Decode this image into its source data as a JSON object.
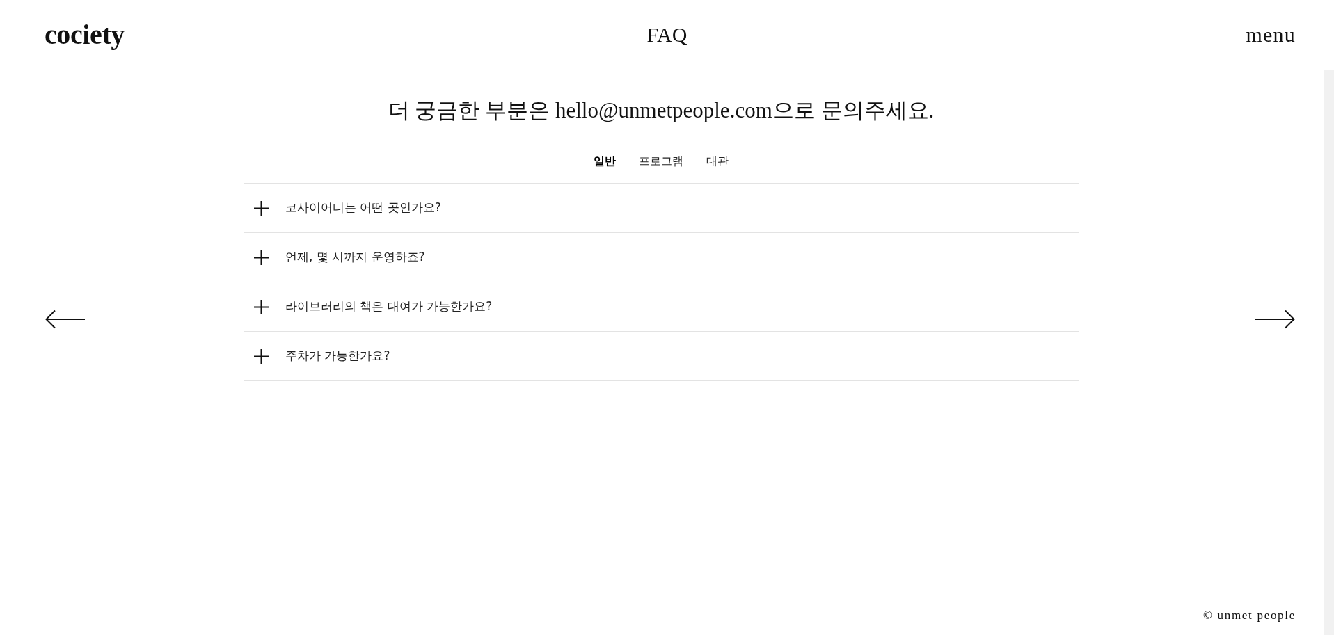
{
  "header": {
    "logo": "cociety",
    "title": "FAQ",
    "menu": "menu"
  },
  "intro": "더 궁금한 부분은 hello@unmetpeople.com으로 문의주세요.",
  "tabs": [
    {
      "label": "일반",
      "selected": true
    },
    {
      "label": "프로그램",
      "selected": false
    },
    {
      "label": "대관",
      "selected": false
    }
  ],
  "questions": [
    {
      "text": "코사이어티는 어떤 곳인가요?",
      "expanded": false
    },
    {
      "text": "언제, 몇 시까지 운영하죠?",
      "expanded": false
    },
    {
      "text": "라이브러리의 책은 대여가 가능한가요?",
      "expanded": false
    },
    {
      "text": "주차가 가능한가요?",
      "expanded": false
    }
  ],
  "footer": {
    "copyright": "© unmet people"
  }
}
